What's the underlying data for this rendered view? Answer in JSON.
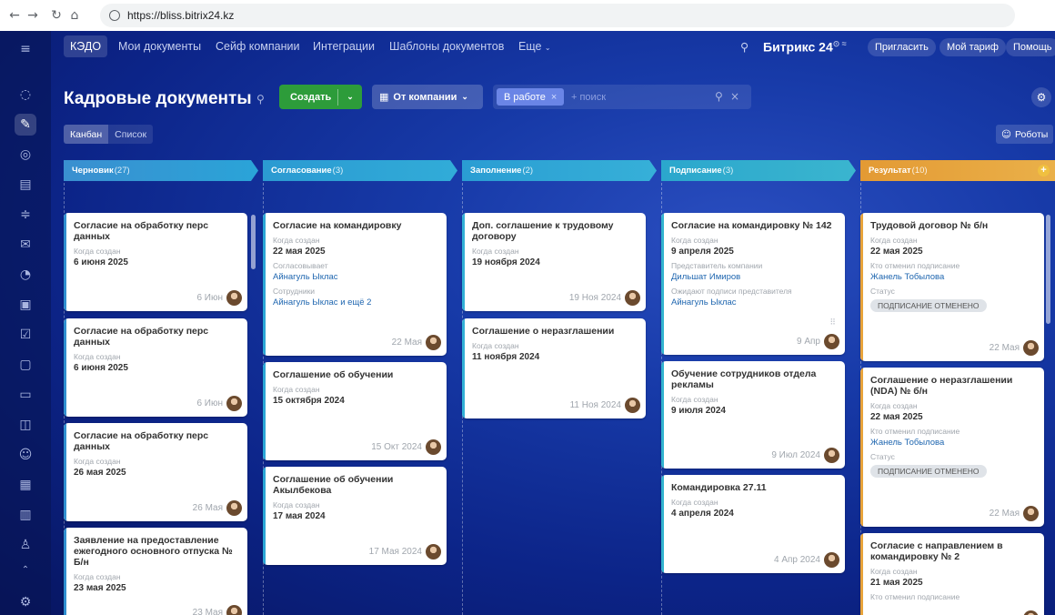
{
  "browser": {
    "url": "https://bliss.bitrix24.kz"
  },
  "topnav": {
    "app": "КЭДО",
    "items": [
      "Мои документы",
      "Сейф компании",
      "Интеграции",
      "Шаблоны документов",
      "Еще"
    ],
    "brand": "Битрикс 24",
    "invite": "Пригласить",
    "tariff": "Мой тариф",
    "help": "Помощь"
  },
  "header": {
    "title": "Кадровые документы",
    "create": "Создать",
    "company": "От компании",
    "filter_chip": "В работе",
    "search_placeholder": "+ поиск"
  },
  "views": {
    "kanban": "Канбан",
    "list": "Список",
    "robots": "Роботы"
  },
  "colors": {
    "accent_green": "#2d9c3a",
    "col_draft": "#2b9ad2",
    "col_result": "#e8a33a",
    "link": "#2067b0"
  },
  "columns": [
    {
      "title": "Черновик",
      "count": "(27)",
      "cards": [
        {
          "title": "Согласие на обработку перс данных",
          "fields": [
            {
              "label": "Когда создан",
              "value": "6 июня 2025"
            }
          ],
          "date": "6 Июн"
        },
        {
          "title": "Согласие на обработку перс данных",
          "fields": [
            {
              "label": "Когда создан",
              "value": "6 июня 2025"
            }
          ],
          "date": "6 Июн"
        },
        {
          "title": "Согласие на обработку перс данных",
          "fields": [
            {
              "label": "Когда создан",
              "value": "26 мая 2025"
            }
          ],
          "date": "26 Мая"
        },
        {
          "title": "Заявление на предоставление ежегодного основного отпуска № Б/н",
          "fields": [
            {
              "label": "Когда создан",
              "value": "23 мая 2025"
            }
          ],
          "date": "23 Мая"
        }
      ]
    },
    {
      "title": "Согласование",
      "count": "(3)",
      "cards": [
        {
          "title": "Согласие на командировку",
          "fields": [
            {
              "label": "Когда создан",
              "value": "22 мая 2025"
            },
            {
              "label": "Согласовывает",
              "link": "Айнагуль Ыклас"
            },
            {
              "label": "Сотрудники",
              "link": "Айнагуль Ыклас и ещё 2"
            }
          ],
          "date": "22 Мая"
        },
        {
          "title": "Соглашение об обучении",
          "fields": [
            {
              "label": "Когда создан",
              "value": "15 октября 2024"
            }
          ],
          "date": "15 Окт 2024"
        },
        {
          "title": "Соглашение об обучении Акылбекова",
          "fields": [
            {
              "label": "Когда создан",
              "value": "17 мая 2024"
            }
          ],
          "date": "17 Мая 2024"
        }
      ]
    },
    {
      "title": "Заполнение",
      "count": "(2)",
      "cards": [
        {
          "title": "Доп. соглашение к трудовому договору",
          "fields": [
            {
              "label": "Когда создан",
              "value": "19 ноября 2024"
            }
          ],
          "date": "19 Ноя 2024"
        },
        {
          "title": "Соглашение о неразглашении",
          "fields": [
            {
              "label": "Когда создан",
              "value": "11 ноября 2024"
            }
          ],
          "date": "11 Ноя 2024"
        }
      ]
    },
    {
      "title": "Подписание",
      "count": "(3)",
      "cards": [
        {
          "title": "Согласие на командировку № 142",
          "fields": [
            {
              "label": "Когда создан",
              "value": "9 апреля 2025"
            },
            {
              "label": "Представитель компании",
              "link": "Дильшат Имиров"
            },
            {
              "label": "Ожидают подписи представителя",
              "link": "Айнагуль Ыклас"
            }
          ],
          "date": "9 Апр"
        },
        {
          "title": "Обучение сотрудников отдела рекламы",
          "fields": [
            {
              "label": "Когда создан",
              "value": "9 июля 2024"
            }
          ],
          "date": "9 Июл 2024"
        },
        {
          "title": "Командировка 27.11",
          "fields": [
            {
              "label": "Когда создан",
              "value": "4 апреля 2024"
            }
          ],
          "date": "4 Апр 2024"
        }
      ]
    },
    {
      "title": "Результат",
      "count": "(10)",
      "cards": [
        {
          "title": "Трудовой договор № б/н",
          "fields": [
            {
              "label": "Когда создан",
              "value": "22 мая 2025"
            },
            {
              "label": "Кто отменил подписание",
              "link": "Жанель Тобылова"
            },
            {
              "label": "Статус",
              "badge": "ПОДПИСАНИЕ ОТМЕНЕНО"
            }
          ],
          "date": "22 Мая"
        },
        {
          "title": "Соглашение о неразглашении (NDA) № б/н",
          "fields": [
            {
              "label": "Когда создан",
              "value": "22 мая 2025"
            },
            {
              "label": "Кто отменил подписание",
              "link": "Жанель Тобылова"
            },
            {
              "label": "Статус",
              "badge": "ПОДПИСАНИЕ ОТМЕНЕНО"
            }
          ],
          "date": "22 Мая"
        },
        {
          "title": "Согласие с направлением в командировку № 2",
          "fields": [
            {
              "label": "Когда создан",
              "value": "21 мая 2025"
            },
            {
              "label": "Кто отменил подписание",
              "link": ""
            }
          ],
          "date": ""
        }
      ]
    }
  ]
}
